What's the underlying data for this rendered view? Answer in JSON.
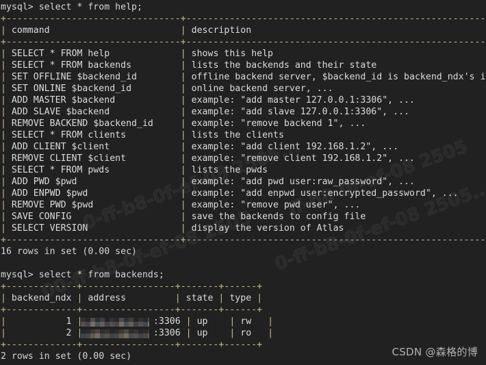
{
  "terminal": {
    "background_color": "#212121",
    "text_color": "#d6d6d6",
    "border_color": "#c9bc8e",
    "prompt": "mysql> ",
    "line1_command": "mysql> select * from help;",
    "line2_command": "mysql> select * from backends;"
  },
  "help_query": {
    "command": "select * from help;",
    "rule": "+--------------------------------+-----------------------------------------------------------+",
    "header": {
      "command": "command",
      "description": "description"
    },
    "rows": [
      {
        "command": "SELECT * FROM help",
        "description": "shows this help"
      },
      {
        "command": "SELECT * FROM backends",
        "description": "lists the backends and their state"
      },
      {
        "command": "SET OFFLINE $backend_id",
        "description": "offline backend server, $backend_id is backend_ndx's id"
      },
      {
        "command": "SET ONLINE $backend_id",
        "description": "online backend server, ..."
      },
      {
        "command": "ADD MASTER $backend",
        "description": "example: \"add master 127.0.0.1:3306\", ..."
      },
      {
        "command": "ADD SLAVE $backend",
        "description": "example: \"add slave 127.0.0.1:3306\", ..."
      },
      {
        "command": "REMOVE BACKEND $backend_id",
        "description": "example: \"remove backend 1\", ..."
      },
      {
        "command": "SELECT * FROM clients",
        "description": "lists the clients"
      },
      {
        "command": "ADD CLIENT $client",
        "description": "example: \"add client 192.168.1.2\", ..."
      },
      {
        "command": "REMOVE CLIENT $client",
        "description": "example: \"remove client 192.168.1.2\", ..."
      },
      {
        "command": "SELECT * FROM pwds",
        "description": "lists the pwds"
      },
      {
        "command": "ADD PWD $pwd",
        "description": "example: \"add pwd user:raw_password\", ..."
      },
      {
        "command": "ADD ENPWD $pwd",
        "description": "example: \"add enpwd user:encrypted_password\", ..."
      },
      {
        "command": "REMOVE PWD $pwd",
        "description": "example: \"remove pwd user\", ..."
      },
      {
        "command": "SAVE CONFIG",
        "description": "save the backends to config file"
      },
      {
        "command": "SELECT VERSION",
        "description": "display the version of Atlas"
      }
    ],
    "result_status": "16 rows in set (0.00 sec)"
  },
  "backends_query": {
    "command": "select * from backends;",
    "rule": "+-------------+-----------------+-------+------+",
    "header": {
      "backend_ndx": "backend_ndx",
      "address": "address",
      "state": "state",
      "type": "type"
    },
    "rows": [
      {
        "backend_ndx": "1",
        "address_port": ":3306",
        "address_redacted": true,
        "state": "up",
        "type": "rw"
      },
      {
        "backend_ndx": "2",
        "address_port": ":3306",
        "address_redacted": true,
        "state": "up",
        "type": "ro"
      }
    ],
    "result_status": "2 rows in set (0.00 sec)"
  },
  "watermarks": {
    "corner": "CSDN @森格的博",
    "diagonal_1": "0-ff-b8-0f-ef-08 2505...",
    "diagonal_2": "00-ff-b8-0f-ef-08 2505",
    "diagonal_3": "ff-b8-0f-ef-08 2505"
  }
}
